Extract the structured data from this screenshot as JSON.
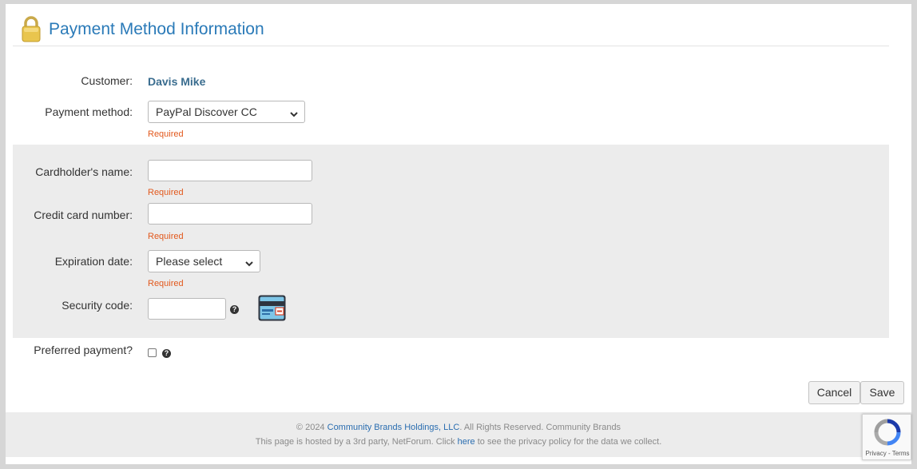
{
  "header": {
    "title": "Payment Method Information"
  },
  "customer": {
    "label": "Customer:",
    "value": "Davis Mike"
  },
  "payment_method": {
    "label": "Payment method:",
    "selected": "PayPal Discover CC",
    "required_text": "Required"
  },
  "cardholder_name": {
    "label": "Cardholder's name:",
    "value": "",
    "required_text": "Required"
  },
  "credit_card_number": {
    "label": "Credit card number:",
    "value": "",
    "required_text": "Required"
  },
  "expiration_date": {
    "label": "Expiration date:",
    "selected": "Please select",
    "required_text": "Required"
  },
  "security_code": {
    "label": "Security code:",
    "value": "",
    "help_glyph": "?"
  },
  "preferred_payment": {
    "label": "Preferred payment?",
    "checked": false,
    "help_glyph": "?"
  },
  "buttons": {
    "cancel": "Cancel",
    "save": "Save"
  },
  "footer": {
    "line1_prefix": "© 2024 ",
    "line1_link": "Community Brands Holdings, LLC",
    "line1_suffix": ". All Rights Reserved. Community Brands",
    "line2_prefix": "This page is hosted by a 3rd party, NetForum. Click ",
    "line2_link": "here",
    "line2_suffix": " to see the privacy policy for the data we collect."
  },
  "recaptcha": {
    "text": "Privacy - Terms"
  },
  "colors": {
    "title": "#2a7ab8",
    "required": "#e2581c",
    "customer_name": "#3a6d8f",
    "panel_bg": "#ececec",
    "link": "#2a6db0"
  },
  "icons": {
    "lock": "lock-icon",
    "card": "credit-card-icon",
    "help": "help-icon",
    "chevron": "chevron-down-icon",
    "recaptcha": "recaptcha-icon"
  }
}
